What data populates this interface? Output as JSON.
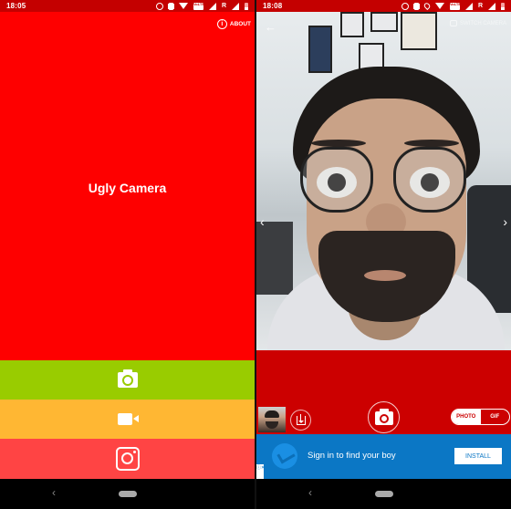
{
  "left_screen": {
    "status_bar": {
      "time": "18:05",
      "icons": [
        "alarm-icon",
        "vibrate-icon",
        "wifi-icon",
        "volte-icon",
        "signal-icon",
        "roaming-indicator",
        "signal-icon",
        "battery-icon"
      ],
      "roaming_label": "R",
      "volte_label": "VoLTE"
    },
    "about_label": "ABOUT",
    "about_icon_glyph": "i",
    "app_title": "Ugly Camera",
    "mode_buttons": [
      {
        "id": "photo",
        "icon": "camera-icon",
        "color": "#99cc00"
      },
      {
        "id": "video",
        "icon": "video-icon",
        "color": "#ffb733"
      },
      {
        "id": "instagram",
        "icon": "instagram-icon",
        "color": "#ff4444"
      }
    ],
    "background_color": "#fe0000",
    "nav": {
      "back_glyph": "‹"
    }
  },
  "right_screen": {
    "status_bar": {
      "time": "18:08",
      "icons": [
        "alarm-icon",
        "vibrate-icon",
        "location-icon",
        "wifi-icon",
        "volte-icon",
        "signal-icon",
        "roaming-indicator",
        "signal-icon",
        "battery-icon"
      ],
      "roaming_label": "R",
      "volte_label": "VoLTE"
    },
    "preview": {
      "back_glyph": "←",
      "switch_camera_label": "SWITCH CAMERA",
      "prev_glyph": "‹",
      "next_glyph": "›"
    },
    "controls": {
      "mode_options": [
        {
          "label": "PHOTO",
          "active": true
        },
        {
          "label": "GIF",
          "active": false
        }
      ],
      "background_color": "#cc0000"
    },
    "ad": {
      "text": "Sign in to find your boy",
      "install_label": "INSTALL",
      "choices_glyph": "ⓘ✕",
      "background_color": "#0b77c5"
    },
    "nav": {
      "back_glyph": "‹"
    }
  }
}
